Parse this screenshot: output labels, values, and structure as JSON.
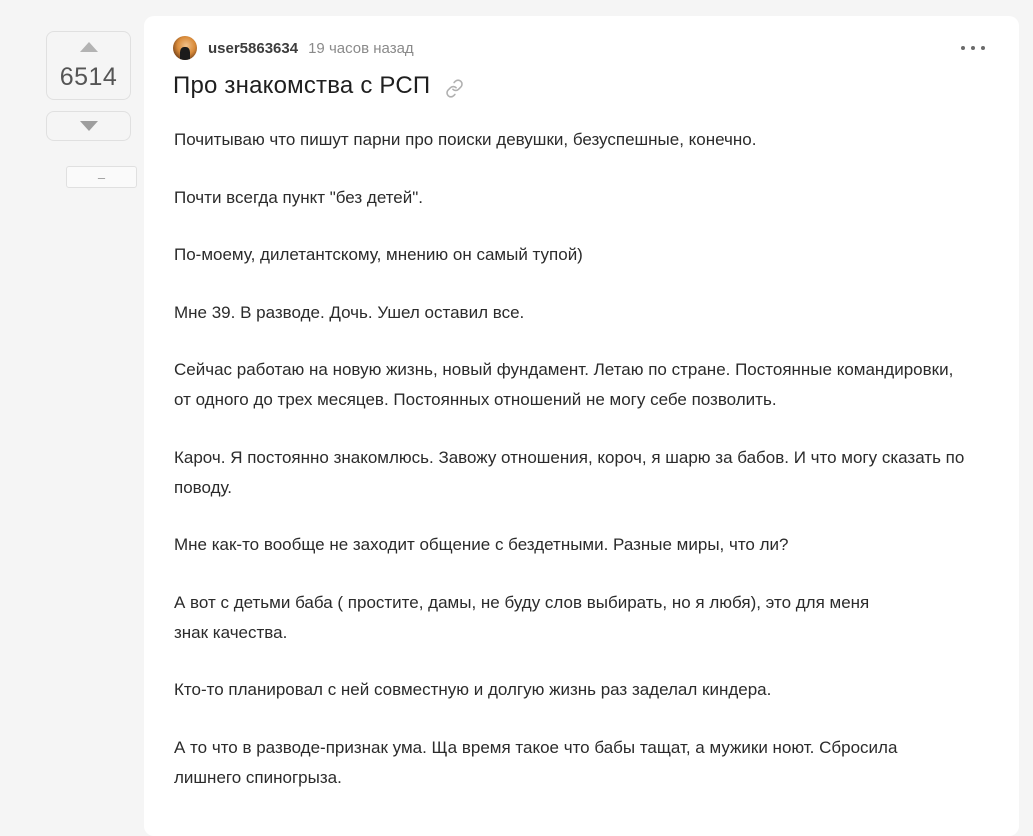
{
  "rating": {
    "value": "6514",
    "collapse_label": "–"
  },
  "story": {
    "author": "user5863634",
    "time": "19 часов назад",
    "title": "Про знакомства с РСП",
    "paragraphs": [
      "Почитываю что пишут парни про поиски девушки, безуспешные, конечно.",
      "Почти всегда пункт \"без детей\".",
      "По-моему, дилетантскому, мнению он самый тупой)",
      "Мне 39. В разводе. Дочь. Ушел оставил все.",
      "Сейчас работаю на новую жизнь, новый фундамент. Летаю по стране. Постоянные командировки, от одного до трех месяцев. Постоянных отношений не могу себе позволить.",
      "Кароч. Я постоянно знакомлюсь. Завожу отношения, короч, я шарю за бабов. И что могу сказать по поводу.",
      "Мне как-то вообще не заходит общение с бездетными. Разные миры, что ли?",
      "А вот с детьми баба ( простите, дамы, не буду слов выбирать, но я любя), это для меня\nзнак качества.",
      "Кто-то планировал с ней совместную и долгую жизнь раз заделал киндера.",
      "А то что в разводе-признак ума. Ща время такое что бабы тащат, а мужики ноют. Сбросила лишнего спиногрыза."
    ]
  },
  "icons": {
    "upvote": "triangle-up-icon",
    "downvote": "triangle-down-icon",
    "more": "more-dots-icon",
    "link": "chain-link-icon",
    "avatar": "user-avatar"
  }
}
